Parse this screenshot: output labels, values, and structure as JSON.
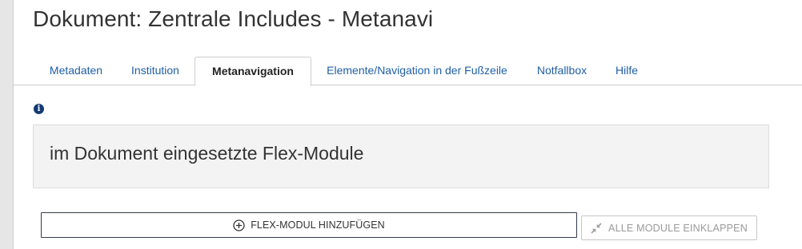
{
  "document": {
    "title": "Dokument: Zentrale Includes - Metanavi"
  },
  "tabs": [
    {
      "label": "Metadaten",
      "active": false
    },
    {
      "label": "Institution",
      "active": false
    },
    {
      "label": "Metanavigation",
      "active": true
    },
    {
      "label": "Elemente/Navigation in der Fußzeile",
      "active": false
    },
    {
      "label": "Notfallbox",
      "active": false
    },
    {
      "label": "Hilfe",
      "active": false
    }
  ],
  "info": {
    "icon": "info-icon",
    "glyph": "i"
  },
  "section": {
    "heading": "im Dokument eingesetzte Flex-Module"
  },
  "actions": {
    "add_module_label": "FLEX-MODUL HINZUFÜGEN",
    "add_module_icon": "plus-circle-icon",
    "collapse_all_label": "ALLE MODULE EINKLAPPEN",
    "collapse_all_icon": "compress-icon"
  },
  "colors": {
    "link": "#1f5fa6",
    "info_icon": "#123a73",
    "section_background": "#f3f3f3",
    "disabled_text": "#999999"
  }
}
